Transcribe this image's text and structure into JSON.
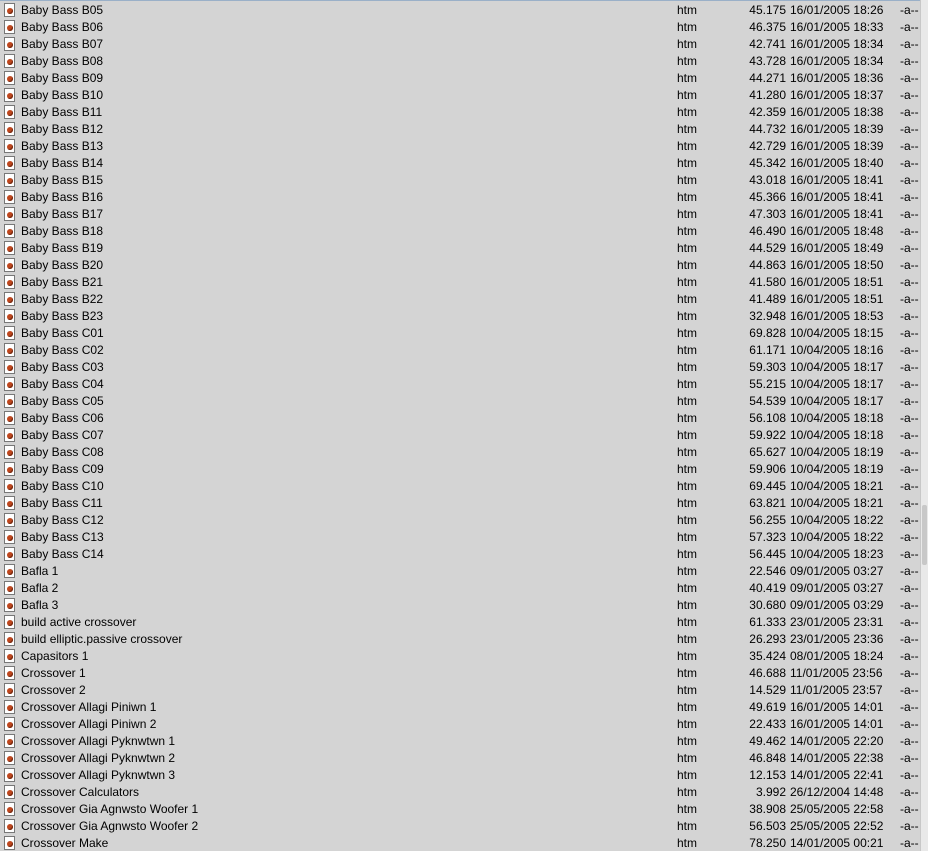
{
  "colors": {
    "background": "#d4d4d4",
    "text": "#000000",
    "icon_accent": "#c0471e"
  },
  "file_icon": "html-document-icon",
  "files": [
    {
      "name": "Baby Bass B05",
      "ext": "htm",
      "size": "45.175",
      "date": "16/01/2005 18:26",
      "attr": "-a--"
    },
    {
      "name": "Baby Bass B06",
      "ext": "htm",
      "size": "46.375",
      "date": "16/01/2005 18:33",
      "attr": "-a--"
    },
    {
      "name": "Baby Bass B07",
      "ext": "htm",
      "size": "42.741",
      "date": "16/01/2005 18:34",
      "attr": "-a--"
    },
    {
      "name": "Baby Bass B08",
      "ext": "htm",
      "size": "43.728",
      "date": "16/01/2005 18:34",
      "attr": "-a--"
    },
    {
      "name": "Baby Bass B09",
      "ext": "htm",
      "size": "44.271",
      "date": "16/01/2005 18:36",
      "attr": "-a--"
    },
    {
      "name": "Baby Bass B10",
      "ext": "htm",
      "size": "41.280",
      "date": "16/01/2005 18:37",
      "attr": "-a--"
    },
    {
      "name": "Baby Bass B11",
      "ext": "htm",
      "size": "42.359",
      "date": "16/01/2005 18:38",
      "attr": "-a--"
    },
    {
      "name": "Baby Bass B12",
      "ext": "htm",
      "size": "44.732",
      "date": "16/01/2005 18:39",
      "attr": "-a--"
    },
    {
      "name": "Baby Bass B13",
      "ext": "htm",
      "size": "42.729",
      "date": "16/01/2005 18:39",
      "attr": "-a--"
    },
    {
      "name": "Baby Bass B14",
      "ext": "htm",
      "size": "45.342",
      "date": "16/01/2005 18:40",
      "attr": "-a--"
    },
    {
      "name": "Baby Bass B15",
      "ext": "htm",
      "size": "43.018",
      "date": "16/01/2005 18:41",
      "attr": "-a--"
    },
    {
      "name": "Baby Bass B16",
      "ext": "htm",
      "size": "45.366",
      "date": "16/01/2005 18:41",
      "attr": "-a--"
    },
    {
      "name": "Baby Bass B17",
      "ext": "htm",
      "size": "47.303",
      "date": "16/01/2005 18:41",
      "attr": "-a--"
    },
    {
      "name": "Baby Bass B18",
      "ext": "htm",
      "size": "46.490",
      "date": "16/01/2005 18:48",
      "attr": "-a--"
    },
    {
      "name": "Baby Bass B19",
      "ext": "htm",
      "size": "44.529",
      "date": "16/01/2005 18:49",
      "attr": "-a--"
    },
    {
      "name": "Baby Bass B20",
      "ext": "htm",
      "size": "44.863",
      "date": "16/01/2005 18:50",
      "attr": "-a--"
    },
    {
      "name": "Baby Bass B21",
      "ext": "htm",
      "size": "41.580",
      "date": "16/01/2005 18:51",
      "attr": "-a--"
    },
    {
      "name": "Baby Bass B22",
      "ext": "htm",
      "size": "41.489",
      "date": "16/01/2005 18:51",
      "attr": "-a--"
    },
    {
      "name": "Baby Bass B23",
      "ext": "htm",
      "size": "32.948",
      "date": "16/01/2005 18:53",
      "attr": "-a--"
    },
    {
      "name": "Baby Bass C01",
      "ext": "htm",
      "size": "69.828",
      "date": "10/04/2005 18:15",
      "attr": "-a--"
    },
    {
      "name": "Baby Bass C02",
      "ext": "htm",
      "size": "61.171",
      "date": "10/04/2005 18:16",
      "attr": "-a--"
    },
    {
      "name": "Baby Bass C03",
      "ext": "htm",
      "size": "59.303",
      "date": "10/04/2005 18:17",
      "attr": "-a--"
    },
    {
      "name": "Baby Bass C04",
      "ext": "htm",
      "size": "55.215",
      "date": "10/04/2005 18:17",
      "attr": "-a--"
    },
    {
      "name": "Baby Bass C05",
      "ext": "htm",
      "size": "54.539",
      "date": "10/04/2005 18:17",
      "attr": "-a--"
    },
    {
      "name": "Baby Bass C06",
      "ext": "htm",
      "size": "56.108",
      "date": "10/04/2005 18:18",
      "attr": "-a--"
    },
    {
      "name": "Baby Bass C07",
      "ext": "htm",
      "size": "59.922",
      "date": "10/04/2005 18:18",
      "attr": "-a--"
    },
    {
      "name": "Baby Bass C08",
      "ext": "htm",
      "size": "65.627",
      "date": "10/04/2005 18:19",
      "attr": "-a--"
    },
    {
      "name": "Baby Bass C09",
      "ext": "htm",
      "size": "59.906",
      "date": "10/04/2005 18:19",
      "attr": "-a--"
    },
    {
      "name": "Baby Bass C10",
      "ext": "htm",
      "size": "69.445",
      "date": "10/04/2005 18:21",
      "attr": "-a--"
    },
    {
      "name": "Baby Bass C11",
      "ext": "htm",
      "size": "63.821",
      "date": "10/04/2005 18:21",
      "attr": "-a--"
    },
    {
      "name": "Baby Bass C12",
      "ext": "htm",
      "size": "56.255",
      "date": "10/04/2005 18:22",
      "attr": "-a--"
    },
    {
      "name": "Baby Bass C13",
      "ext": "htm",
      "size": "57.323",
      "date": "10/04/2005 18:22",
      "attr": "-a--"
    },
    {
      "name": "Baby Bass C14",
      "ext": "htm",
      "size": "56.445",
      "date": "10/04/2005 18:23",
      "attr": "-a--"
    },
    {
      "name": "Bafla 1",
      "ext": "htm",
      "size": "22.546",
      "date": "09/01/2005 03:27",
      "attr": "-a--"
    },
    {
      "name": "Bafla 2",
      "ext": "htm",
      "size": "40.419",
      "date": "09/01/2005 03:27",
      "attr": "-a--"
    },
    {
      "name": "Bafla 3",
      "ext": "htm",
      "size": "30.680",
      "date": "09/01/2005 03:29",
      "attr": "-a--"
    },
    {
      "name": "build active crossover",
      "ext": "htm",
      "size": "61.333",
      "date": "23/01/2005 23:31",
      "attr": "-a--"
    },
    {
      "name": "build elliptic.passive crossover",
      "ext": "htm",
      "size": "26.293",
      "date": "23/01/2005 23:36",
      "attr": "-a--"
    },
    {
      "name": "Capasitors 1",
      "ext": "htm",
      "size": "35.424",
      "date": "08/01/2005 18:24",
      "attr": "-a--"
    },
    {
      "name": "Crossover 1",
      "ext": "htm",
      "size": "46.688",
      "date": "11/01/2005 23:56",
      "attr": "-a--"
    },
    {
      "name": "Crossover 2",
      "ext": "htm",
      "size": "14.529",
      "date": "11/01/2005 23:57",
      "attr": "-a--"
    },
    {
      "name": "Crossover Allagi Piniwn 1",
      "ext": "htm",
      "size": "49.619",
      "date": "16/01/2005 14:01",
      "attr": "-a--"
    },
    {
      "name": "Crossover Allagi Piniwn 2",
      "ext": "htm",
      "size": "22.433",
      "date": "16/01/2005 14:01",
      "attr": "-a--"
    },
    {
      "name": "Crossover Allagi Pyknwtwn 1",
      "ext": "htm",
      "size": "49.462",
      "date": "14/01/2005 22:20",
      "attr": "-a--"
    },
    {
      "name": "Crossover Allagi Pyknwtwn 2",
      "ext": "htm",
      "size": "46.848",
      "date": "14/01/2005 22:38",
      "attr": "-a--"
    },
    {
      "name": "Crossover Allagi Pyknwtwn 3",
      "ext": "htm",
      "size": "12.153",
      "date": "14/01/2005 22:41",
      "attr": "-a--"
    },
    {
      "name": "Crossover Calculators",
      "ext": "htm",
      "size": "3.992",
      "date": "26/12/2004 14:48",
      "attr": "-a--"
    },
    {
      "name": "Crossover Gia Agnwsto Woofer 1",
      "ext": "htm",
      "size": "38.908",
      "date": "25/05/2005 22:58",
      "attr": "-a--"
    },
    {
      "name": "Crossover Gia Agnwsto Woofer 2",
      "ext": "htm",
      "size": "56.503",
      "date": "25/05/2005 22:52",
      "attr": "-a--"
    },
    {
      "name": "Crossover Make",
      "ext": "htm",
      "size": "78.250",
      "date": "14/01/2005 00:21",
      "attr": "-a--"
    }
  ]
}
